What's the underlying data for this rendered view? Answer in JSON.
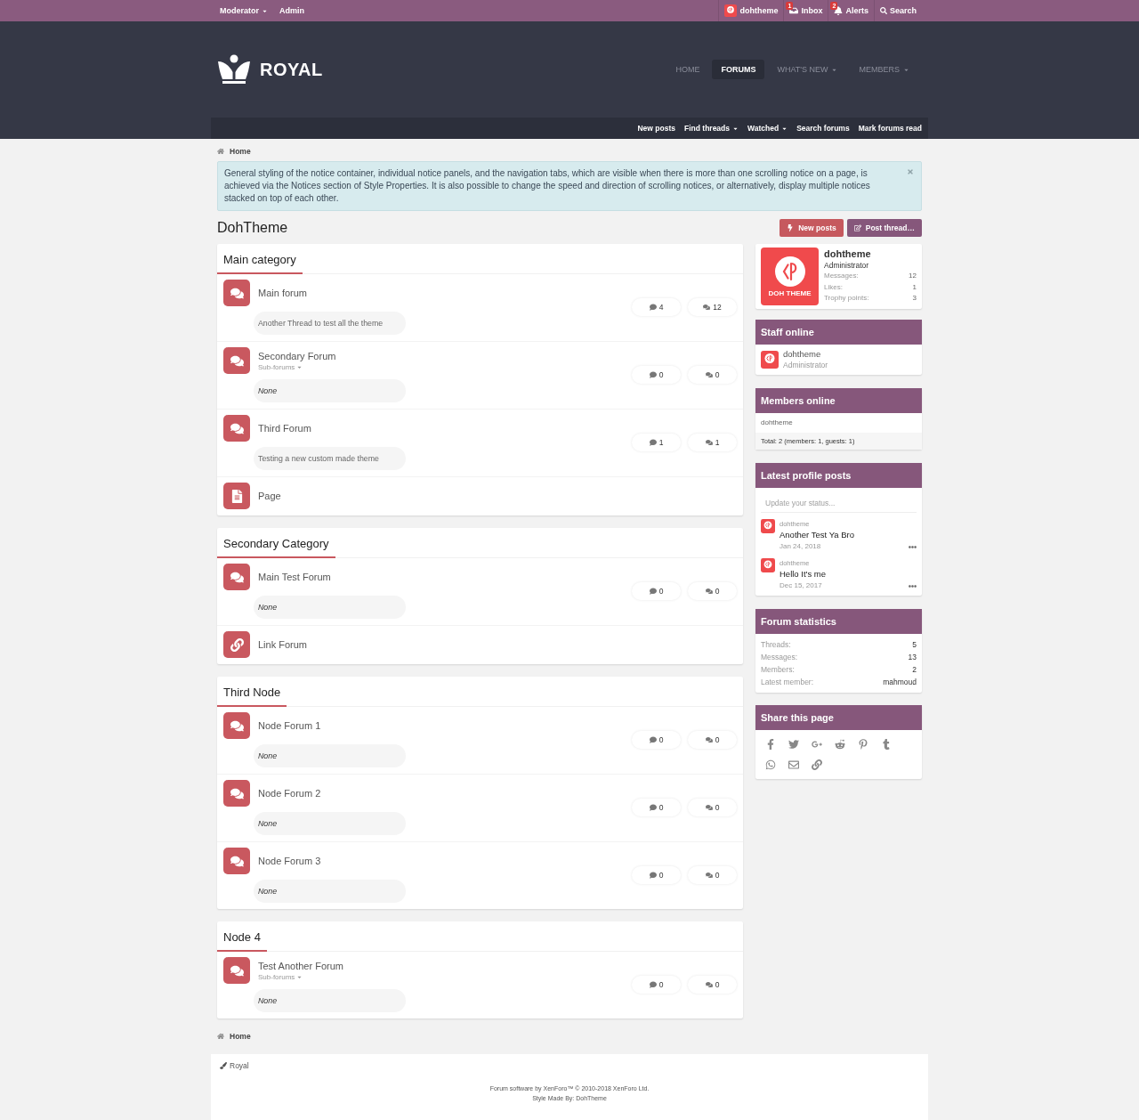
{
  "top_bar": {
    "left": [
      {
        "label": "Moderator",
        "dropdown": true
      },
      {
        "label": "Admin",
        "dropdown": false
      }
    ],
    "right": [
      {
        "kind": "user",
        "label": "dohtheme"
      },
      {
        "kind": "inbox",
        "label": "Inbox",
        "badge": "1"
      },
      {
        "kind": "alerts",
        "label": "Alerts",
        "badge": "2"
      },
      {
        "kind": "search",
        "label": "Search"
      }
    ]
  },
  "header": {
    "logo_text": "ROYAL",
    "nav": [
      {
        "label": "HOME",
        "selected": false,
        "dropdown": false
      },
      {
        "label": "FORUMS",
        "selected": true,
        "dropdown": false
      },
      {
        "label": "WHAT'S NEW",
        "selected": false,
        "dropdown": true
      },
      {
        "label": "MEMBERS",
        "selected": false,
        "dropdown": true
      }
    ],
    "sub_nav": [
      {
        "label": "New posts",
        "dropdown": false
      },
      {
        "label": "Find threads",
        "dropdown": true
      },
      {
        "label": "Watched",
        "dropdown": true
      },
      {
        "label": "Search forums",
        "dropdown": false
      },
      {
        "label": "Mark forums read",
        "dropdown": false
      }
    ]
  },
  "breadcrumb": [
    {
      "label": "Home"
    }
  ],
  "notice": {
    "text": "General styling of the notice container, individual notice panels, and the navigation tabs, which are visible when there is more than one scrolling notice on a page, is achieved via the Notices section of Style Properties. It is also possible to change the speed and direction of scrolling notices, or alternatively, display multiple notices stacked on top of each other."
  },
  "page_title": "DohTheme",
  "actions": [
    {
      "kind": "new_posts",
      "label": "New posts"
    },
    {
      "kind": "post_thread",
      "label": "Post thread…"
    }
  ],
  "categories": [
    {
      "title": "Main category",
      "nodes": [
        {
          "kind": "forum",
          "title": "Main forum",
          "threads": "4",
          "messages": "12",
          "last_post": "Another Thread to test all the theme",
          "no_posts": false
        },
        {
          "kind": "forum",
          "title": "Secondary Forum",
          "sub_forums": "Sub-forums",
          "threads": "0",
          "messages": "0",
          "last_post": "None",
          "no_posts": true
        },
        {
          "kind": "forum",
          "title": "Third Forum",
          "threads": "1",
          "messages": "1",
          "last_post": "Testing a new custom made theme",
          "no_posts": false
        },
        {
          "kind": "page",
          "title": "Page"
        }
      ]
    },
    {
      "title": "Secondary Category",
      "nodes": [
        {
          "kind": "forum",
          "title": "Main Test Forum",
          "threads": "0",
          "messages": "0",
          "last_post": "None",
          "no_posts": true
        },
        {
          "kind": "link",
          "title": "Link Forum"
        }
      ]
    },
    {
      "title": "Third Node",
      "nodes": [
        {
          "kind": "forum",
          "title": "Node Forum 1",
          "threads": "0",
          "messages": "0",
          "last_post": "None",
          "no_posts": true
        },
        {
          "kind": "forum",
          "title": "Node Forum 2",
          "threads": "0",
          "messages": "0",
          "last_post": "None",
          "no_posts": true
        },
        {
          "kind": "forum",
          "title": "Node Forum 3",
          "threads": "0",
          "messages": "0",
          "last_post": "None",
          "no_posts": true
        }
      ]
    },
    {
      "title": "Node 4",
      "nodes": [
        {
          "kind": "forum",
          "title": "Test Another Forum",
          "sub_forums": "Sub-forums",
          "threads": "0",
          "messages": "0",
          "last_post": "None",
          "no_posts": true
        }
      ]
    }
  ],
  "bottom_breadcrumb": [
    {
      "label": "Home"
    }
  ],
  "sidebar": {
    "member": {
      "avatar_label": "DOH THEME",
      "name": "dohtheme",
      "role": "Administrator",
      "stats": [
        {
          "label": "Messages:",
          "value": "12"
        },
        {
          "label": "Likes:",
          "value": "1"
        },
        {
          "label": "Trophy points:",
          "value": "3"
        }
      ]
    },
    "staff_online": {
      "title": "Staff online",
      "members": [
        {
          "name": "dohtheme",
          "role": "Administrator"
        }
      ]
    },
    "members_online": {
      "title": "Members online",
      "members": [
        "dohtheme"
      ],
      "total": "Total: 2 (members: 1, guests: 1)"
    },
    "profile_posts": {
      "title": "Latest profile posts",
      "placeholder": "Update your status...",
      "posts": [
        {
          "author": "dohtheme",
          "text": "Another Test Ya Bro",
          "date": "Jan 24, 2018"
        },
        {
          "author": "dohtheme",
          "text": "Hello It's me",
          "date": "Dec 15, 2017"
        }
      ]
    },
    "forum_statistics": {
      "title": "Forum statistics",
      "rows": [
        {
          "label": "Threads:",
          "value": "5"
        },
        {
          "label": "Messages:",
          "value": "13"
        },
        {
          "label": "Members:",
          "value": "2"
        },
        {
          "label": "Latest member:",
          "value": "mahmoud"
        }
      ]
    },
    "share": {
      "title": "Share this page"
    }
  },
  "footer": {
    "style_link": "Royal",
    "copyright": "Forum software by XenForo™ © 2010-2018 XenForo Ltd.",
    "credit": "Style Made By: DohTheme"
  }
}
